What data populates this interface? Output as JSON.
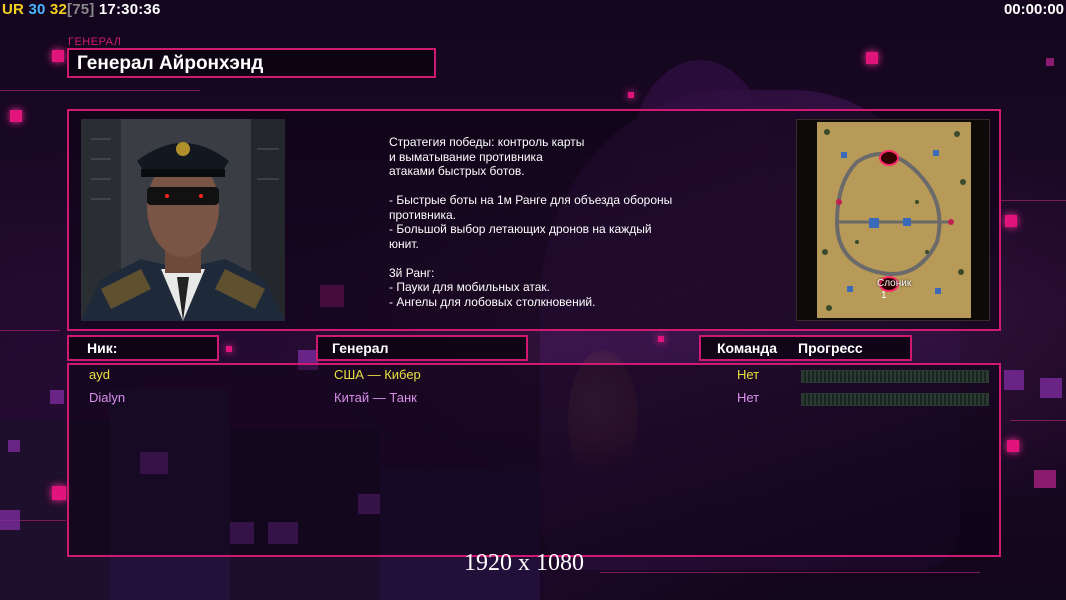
{
  "hud": {
    "ur_label": "UR",
    "fps_value": "30",
    "fps_target": "32",
    "fps_bracket": "[75]",
    "clock": "17:30:36",
    "game_timer": "00:00:00"
  },
  "general": {
    "tag": "ГЕНЕРАЛ",
    "name": "Генерал Айронхэнд",
    "strategy": "Стратегия победы: контроль карты\nи выматывание противника\nатаками быстрых ботов.\n\n- Быстрые боты на 1м Ранге для объезда обороны\n противника.\n- Большой выбор летающих дронов на каждый\n юнит.\n\n3й Ранг:\n- Пауки для мобильных атак.\n- Ангелы для лобовых столкновений."
  },
  "minimap": {
    "map_name": "Слоник",
    "player_slot": "1"
  },
  "table": {
    "headers": {
      "nick": "Ник:",
      "general": "Генерал",
      "team": "Команда",
      "progress": "Прогресс"
    },
    "rows": [
      {
        "nick": "ayd",
        "general": "США — Кибер",
        "team": "Нет",
        "progress": 0,
        "color": "#e8e040"
      },
      {
        "nick": "Dialyn",
        "general": "Китай — Танк",
        "team": "Нет",
        "progress": 0,
        "color": "#d890e8"
      }
    ]
  },
  "resolution": "1920 x 1080",
  "colors": {
    "accent": "#d01a72",
    "player1": "#e8e040",
    "player2": "#d890e8"
  }
}
